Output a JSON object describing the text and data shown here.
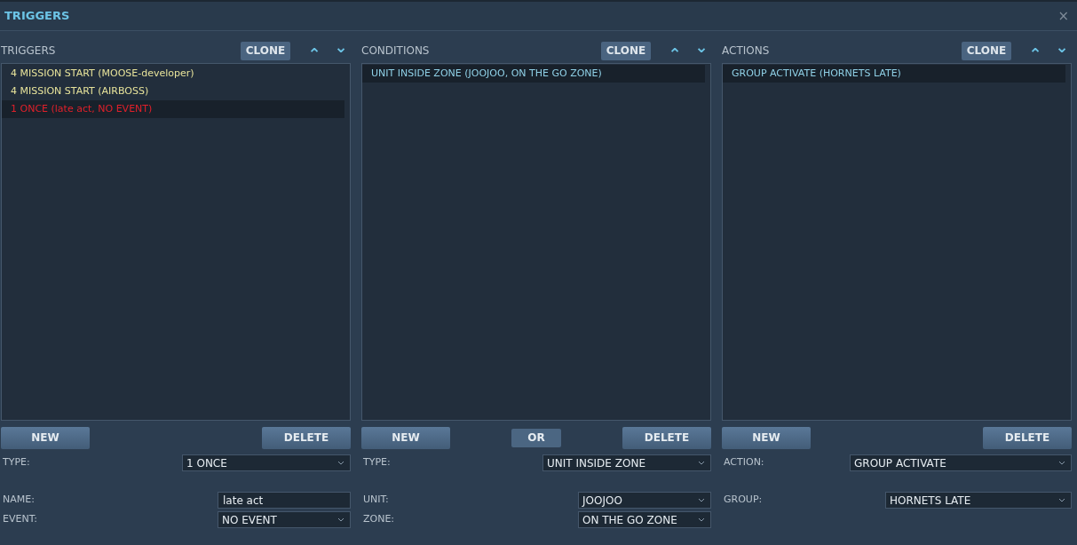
{
  "window": {
    "title": "TRIGGERS",
    "close": "×"
  },
  "panels": [
    {
      "heading": "TRIGGERS",
      "clone": "CLONE",
      "up": "⌃",
      "down": "⌄",
      "items": [
        {
          "label": "4 MISSION START (MOOSE-developer)",
          "color": "#e6e29a",
          "selected": false
        },
        {
          "label": "4 MISSION START (AIRBOSS)",
          "color": "#e6e29a",
          "selected": false
        },
        {
          "label": "1 ONCE (late act, NO EVENT)",
          "color": "#e0202a",
          "selected": true
        }
      ],
      "buttons": [
        "NEW",
        "DELETE"
      ],
      "type_field": {
        "label": "TYPE:",
        "value": "1 ONCE",
        "kind": "dropdown"
      },
      "fields": [
        {
          "label": "NAME:",
          "value": "late act",
          "kind": "text"
        },
        {
          "label": "EVENT:",
          "value": "NO EVENT",
          "kind": "dropdown"
        }
      ]
    },
    {
      "heading": "CONDITIONS",
      "clone": "CLONE",
      "up": "⌃",
      "down": "⌄",
      "items": [
        {
          "label": "UNIT INSIDE ZONE (JOOJOO, ON THE GO ZONE)",
          "selected": true
        }
      ],
      "buttons": [
        "NEW",
        "OR",
        "DELETE"
      ],
      "type_field": {
        "label": "TYPE:",
        "value": "UNIT INSIDE ZONE",
        "kind": "dropdown"
      },
      "fields": [
        {
          "label": "UNIT:",
          "value": "JOOJOO",
          "kind": "dropdown"
        },
        {
          "label": "ZONE:",
          "value": "ON THE GO ZONE",
          "kind": "dropdown"
        }
      ]
    },
    {
      "heading": "ACTIONS",
      "clone": "CLONE",
      "up": "⌃",
      "down": "⌄",
      "items": [
        {
          "label": "GROUP ACTIVATE (HORNETS LATE)",
          "selected": true
        }
      ],
      "buttons": [
        "NEW",
        "DELETE"
      ],
      "type_field": {
        "label": "ACTION:",
        "value": "GROUP ACTIVATE",
        "kind": "dropdown"
      },
      "fields": [
        {
          "label": "GROUP:",
          "value": "HORNETS LATE",
          "kind": "dropdown"
        }
      ]
    }
  ]
}
